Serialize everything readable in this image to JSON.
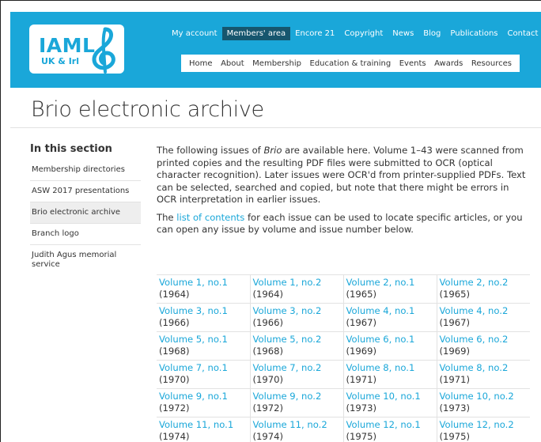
{
  "logo": {
    "text": "IAML",
    "sub": "UK & Irl"
  },
  "colors": {
    "brand": "#1aa7d9",
    "active_tab": "#16566e",
    "link": "#1aa7d9",
    "text": "#333333"
  },
  "topnav": [
    {
      "label": "My account"
    },
    {
      "label": "Members' area",
      "active": true
    },
    {
      "label": "Encore 21"
    },
    {
      "label": "Copyright"
    },
    {
      "label": "News"
    },
    {
      "label": "Blog"
    },
    {
      "label": "Publications"
    },
    {
      "label": "Contact"
    }
  ],
  "search_icon": "search-icon",
  "mainnav": [
    {
      "label": "Home"
    },
    {
      "label": "About"
    },
    {
      "label": "Membership"
    },
    {
      "label": "Education & training"
    },
    {
      "label": "Events"
    },
    {
      "label": "Awards"
    },
    {
      "label": "Resources"
    }
  ],
  "page_title": "Brio electronic archive",
  "sidebar": {
    "heading": "In this section",
    "items": [
      {
        "label": "Membership directories"
      },
      {
        "label": "ASW 2017 presentations"
      },
      {
        "label": "Brio electronic archive",
        "selected": true
      },
      {
        "label": "Branch logo"
      },
      {
        "label": "Judith Agus memorial service"
      }
    ]
  },
  "intro": {
    "p1_before": "The following issues of ",
    "p1_em": "Brio",
    "p1_after": " are available here. Volume 1–43 were scanned from printed copies and the resulting PDF files were submitted to OCR (optical character recognition). Later issues were OCR'd from printer-supplied PDFs. Text can be selected, searched and copied, but note that there might be errors in OCR interpretation in earlier issues.",
    "p2_before": "The ",
    "p2_link": "list of contents",
    "p2_after": " for each issue can be used to locate specific articles, or you can open any issue by volume and issue number below."
  },
  "issues": [
    [
      {
        "title": "Volume 1, no.1",
        "year": "(1964)"
      },
      {
        "title": "Volume 1, no.2",
        "year": "(1964)"
      },
      {
        "title": "Volume 2, no.1",
        "year": "(1965)"
      },
      {
        "title": "Volume 2, no.2",
        "year": "(1965)"
      }
    ],
    [
      {
        "title": "Volume 3, no.1",
        "year": "(1966)"
      },
      {
        "title": "Volume 3, no.2",
        "year": "(1966)"
      },
      {
        "title": "Volume 4, no.1",
        "year": "(1967)"
      },
      {
        "title": "Volume 4, no.2",
        "year": "(1967)"
      }
    ],
    [
      {
        "title": "Volume 5, no.1",
        "year": "(1968)"
      },
      {
        "title": "Volume 5, no.2",
        "year": "(1968)"
      },
      {
        "title": "Volume 6, no.1",
        "year": "(1969)"
      },
      {
        "title": "Volume 6, no.2",
        "year": "(1969)"
      }
    ],
    [
      {
        "title": "Volume 7, no.1",
        "year": "(1970)"
      },
      {
        "title": "Volume 7, no.2",
        "year": "(1970)"
      },
      {
        "title": "Volume 8, no.1",
        "year": "(1971)"
      },
      {
        "title": "Volume 8, no.2",
        "year": "(1971)"
      }
    ],
    [
      {
        "title": "Volume 9, no.1",
        "year": "(1972)"
      },
      {
        "title": "Volume 9, no.2",
        "year": "(1972)"
      },
      {
        "title": "Volume 10, no.1",
        "year": "(1973)"
      },
      {
        "title": "Volume 10, no.2",
        "year": "(1973)"
      }
    ],
    [
      {
        "title": "Volume 11, no.1",
        "year": "(1974)"
      },
      {
        "title": "Volume 11, no.2",
        "year": "(1974)"
      },
      {
        "title": "Volume 12, no.1",
        "year": "(1975)"
      },
      {
        "title": "Volume 12, no.2",
        "year": "(1975)"
      }
    ]
  ]
}
